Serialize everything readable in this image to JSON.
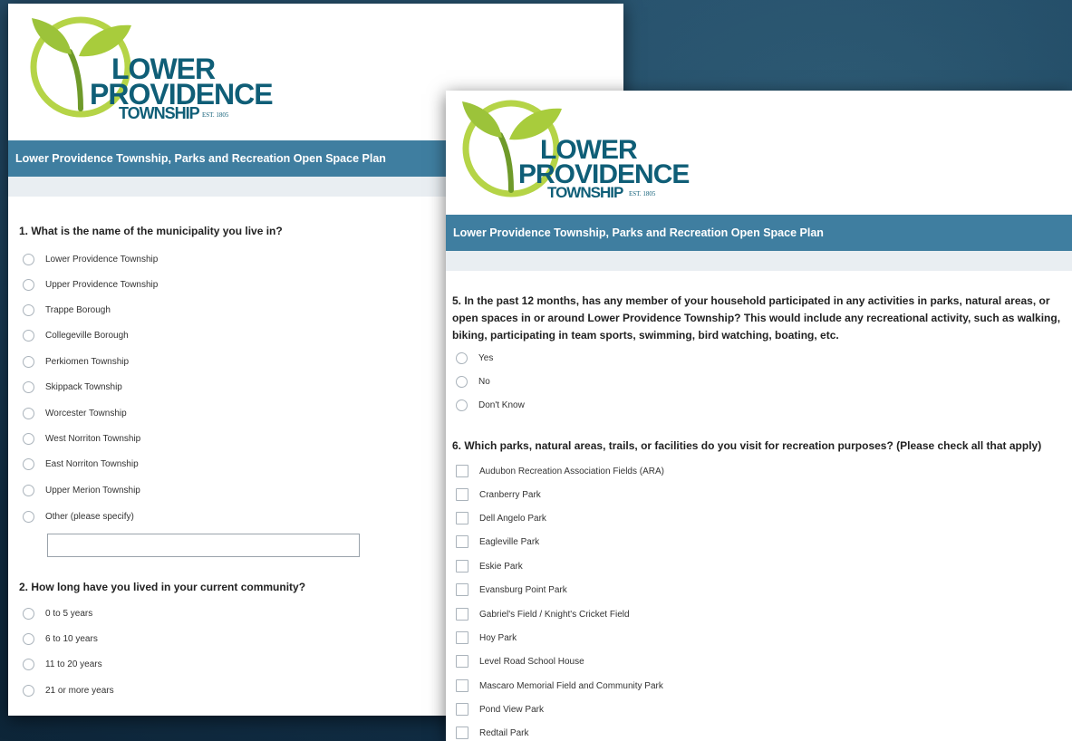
{
  "brand": {
    "logo_line1": "LOWER",
    "logo_line2": "PROVIDENCE",
    "logo_line3": "TOWNSHIP",
    "logo_est": "EST. 1805"
  },
  "panel1": {
    "banner": "Lower Providence Township, Parks and Recreation Open Space Plan",
    "q1": {
      "text": "1. What is the name of the municipality you live in?",
      "options": [
        "Lower Providence Township",
        "Upper Providence Township",
        "Trappe Borough",
        "Collegeville Borough",
        "Perkiomen Township",
        "Skippack Township",
        "Worcester Township",
        "West Norriton Township",
        "East Norriton Township",
        "Upper Merion Township",
        "Other (please specify)"
      ],
      "other_value": ""
    },
    "q2": {
      "text": "2. How long have you lived in your current community?",
      "options": [
        "0 to 5 years",
        "6 to 10 years",
        "11 to 20 years",
        "21 or more years"
      ]
    }
  },
  "panel2": {
    "banner": "Lower Providence Township, Parks and Recreation Open Space Plan",
    "q5": {
      "line1": "5. In the past 12 months, has any member of your household participated in any activities in parks, natural areas, or",
      "line2": "open spaces in or around Lower Providence Township? This would include any recreational activity, such as walking,",
      "line3": "biking, participating in team sports, swimming, bird watching, boating, etc.",
      "options": [
        "Yes",
        "No",
        "Don't Know"
      ]
    },
    "q6": {
      "text": "6. Which parks, natural areas, trails, or facilities do you visit for recreation purposes? (Please check all that apply)",
      "options": [
        "Audubon Recreation Association Fields (ARA)",
        "Cranberry Park",
        "Dell Angelo Park",
        "Eagleville Park",
        "Eskie Park",
        "Evansburg Point Park",
        "Gabriel's Field / Knight's Cricket Field",
        "Hoy Park",
        "Level Road School House",
        "Mascaro Memorial Field and Community Park",
        "Pond View Park",
        "Redtail Park"
      ]
    }
  },
  "colors": {
    "banner": "#3f7ea0",
    "logo_green": "#a8cc3c",
    "logo_blue": "#0f5e77"
  }
}
